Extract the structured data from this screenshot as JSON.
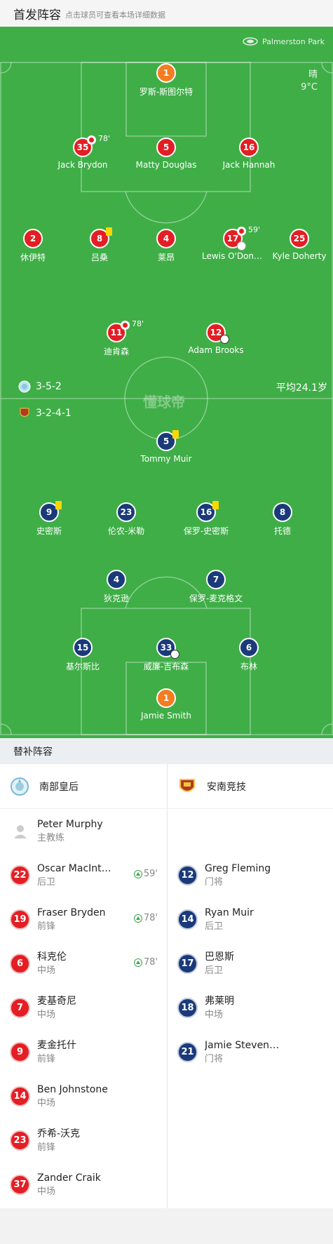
{
  "header": {
    "title": "首发阵容",
    "subtitle": "点击球员可查看本场详细数据"
  },
  "pitch": {
    "venue": "Palmerston Park",
    "weather": "晴",
    "temperature": "9°C",
    "watermark": "懂球帝",
    "avg_age": "平均24.1岁",
    "home_formation": "3-5-2",
    "away_formation": "3-2-4-1"
  },
  "home_players": [
    {
      "num": "1",
      "name": "罗斯-斯图尔特",
      "gk": true
    },
    {
      "num": "35",
      "name": "Jack Brydon",
      "sub_off": "78'"
    },
    {
      "num": "5",
      "name": "Matty Douglas"
    },
    {
      "num": "16",
      "name": "Jack Hannah"
    },
    {
      "num": "2",
      "name": "休伊特"
    },
    {
      "num": "8",
      "name": "吕桑",
      "yellow": true
    },
    {
      "num": "4",
      "name": "莱昂"
    },
    {
      "num": "17",
      "name": "Lewis O'Donnell",
      "sub_off": "59'",
      "ball": true
    },
    {
      "num": "25",
      "name": "Kyle Doherty"
    },
    {
      "num": "11",
      "name": "迪肯森",
      "sub_off": "78'"
    },
    {
      "num": "12",
      "name": "Adam Brooks",
      "goal": true
    }
  ],
  "away_players": [
    {
      "num": "5",
      "name": "Tommy Muir",
      "yellow": true
    },
    {
      "num": "9",
      "name": "史密斯",
      "yellow": true
    },
    {
      "num": "23",
      "name": "伦农-米勒"
    },
    {
      "num": "16",
      "name": "保罗-史密斯",
      "yellow": true
    },
    {
      "num": "8",
      "name": "托德"
    },
    {
      "num": "4",
      "name": "狄克逊"
    },
    {
      "num": "7",
      "name": "保罗-麦克格文"
    },
    {
      "num": "15",
      "name": "基尔斯比"
    },
    {
      "num": "33",
      "name": "威廉-吉布森",
      "goal": true
    },
    {
      "num": "6",
      "name": "布林"
    },
    {
      "num": "1",
      "name": "Jamie Smith",
      "gk": true
    }
  ],
  "bench": {
    "title": "替补阵容",
    "home_team": "南部皇后",
    "away_team": "安南竞技",
    "coach": {
      "name": "Peter Murphy",
      "role": "主教练"
    },
    "home": [
      {
        "num": "22",
        "name": "Oscar MacIntyre",
        "pos": "后卫",
        "sub_in": "59'"
      },
      {
        "num": "19",
        "name": "Fraser Bryden",
        "pos": "前锋",
        "sub_in": "78'"
      },
      {
        "num": "6",
        "name": "科克伦",
        "pos": "中场",
        "sub_in": "78'"
      },
      {
        "num": "7",
        "name": "麦基奇尼",
        "pos": "中场"
      },
      {
        "num": "9",
        "name": "麦金托什",
        "pos": "前锋"
      },
      {
        "num": "14",
        "name": "Ben Johnstone",
        "pos": "中场"
      },
      {
        "num": "23",
        "name": "乔希-沃克",
        "pos": "前锋"
      },
      {
        "num": "37",
        "name": "Zander Craik",
        "pos": "中场"
      }
    ],
    "away": [
      {
        "num": "12",
        "name": "Greg Fleming",
        "pos": "门将"
      },
      {
        "num": "14",
        "name": "Ryan Muir",
        "pos": "后卫"
      },
      {
        "num": "17",
        "name": "巴恩斯",
        "pos": "后卫"
      },
      {
        "num": "18",
        "name": "弗莱明",
        "pos": "中场"
      },
      {
        "num": "21",
        "name": "Jamie Stevenson",
        "pos": "门将"
      }
    ]
  },
  "colors": {
    "pitch": "#3fae47",
    "home": "#e31e24",
    "away": "#1a3a7a",
    "gk": "#f57c1f",
    "card": "#ffd600"
  }
}
